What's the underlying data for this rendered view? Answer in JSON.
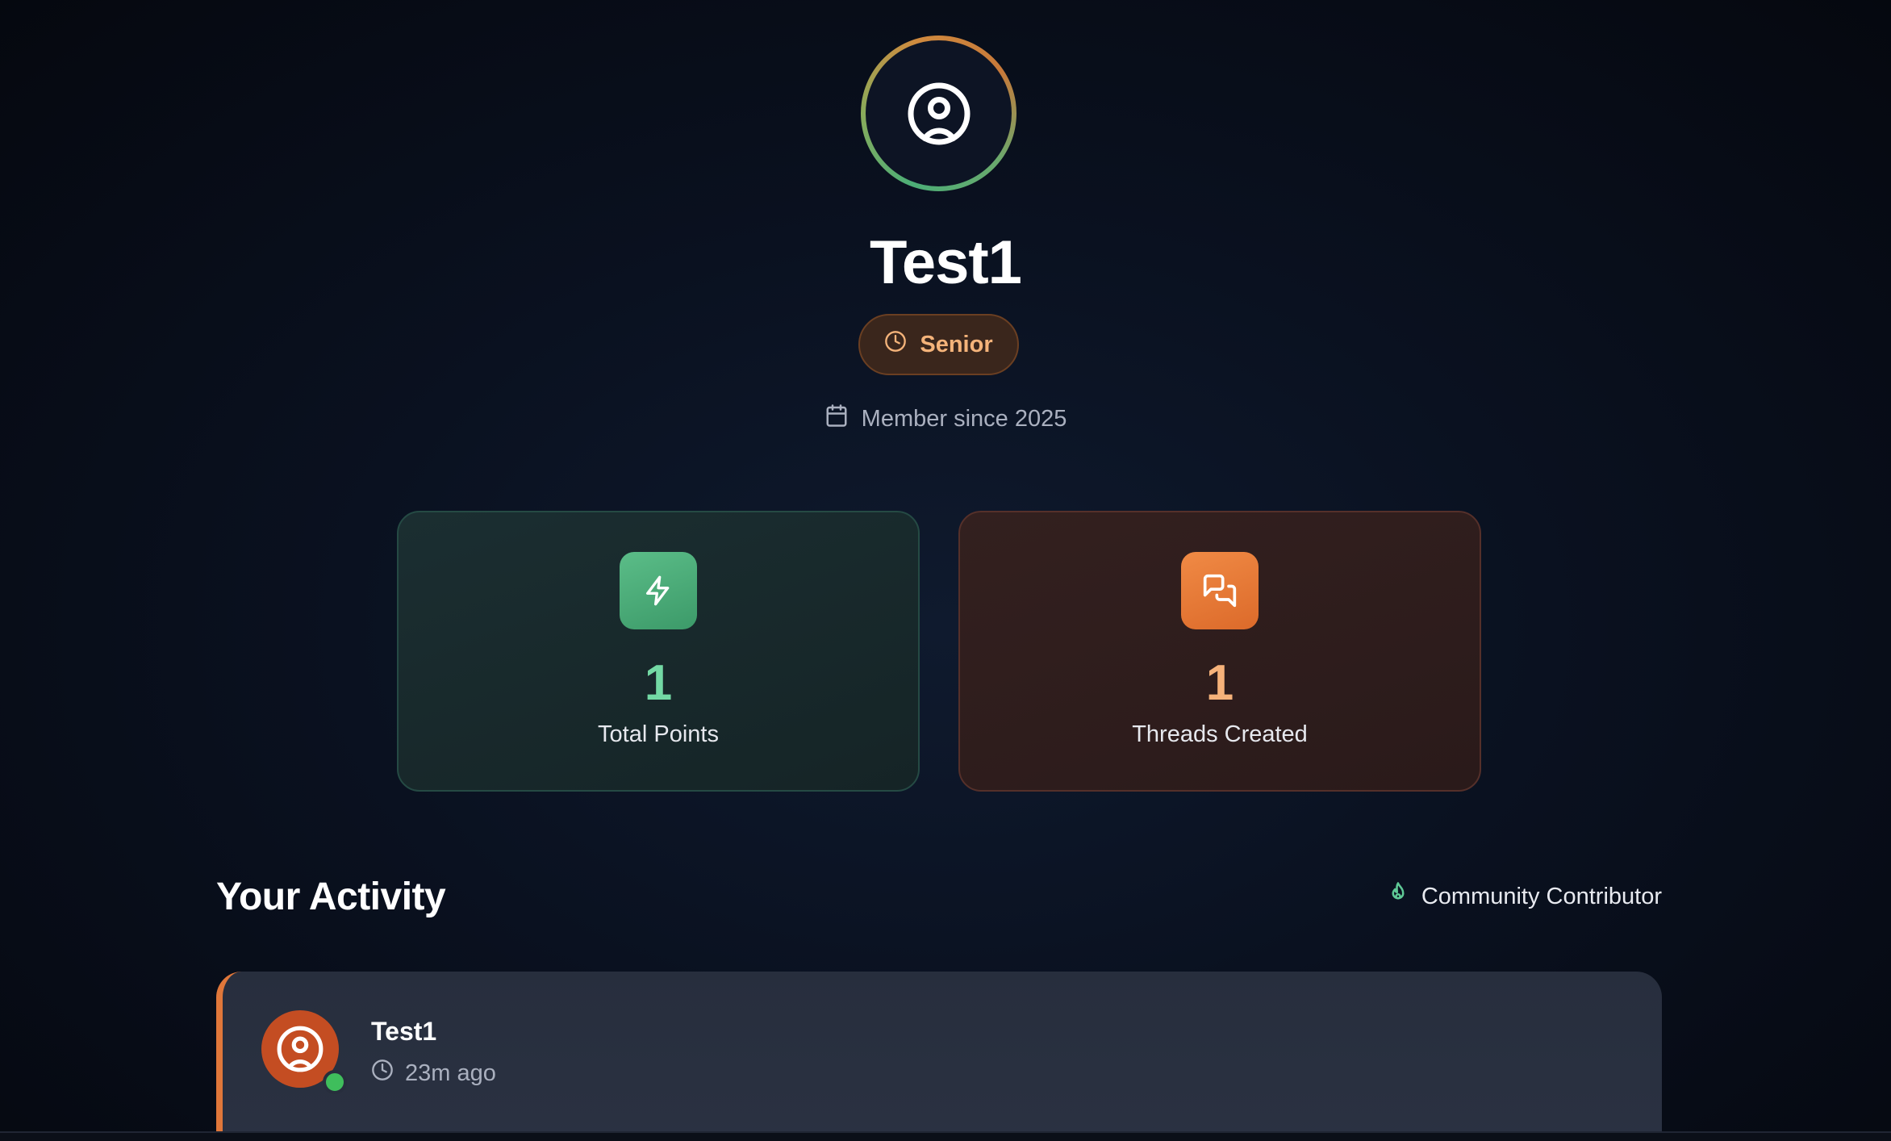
{
  "profile": {
    "name": "Test1",
    "rank": "Senior",
    "member_since": "Member since 2025"
  },
  "stats": [
    {
      "value": "1",
      "label": "Total Points",
      "icon": "lightning-icon",
      "accent": "#4caf7d"
    },
    {
      "value": "1",
      "label": "Threads Created",
      "icon": "chat-bubbles-icon",
      "accent": "#e97a36"
    }
  ],
  "activity": {
    "title": "Your Activity",
    "badge": "Community Contributor",
    "posts": [
      {
        "author": "Test1",
        "time": "23m ago",
        "body": ""
      }
    ]
  },
  "colors": {
    "green_accent": "#73d9a4",
    "orange_accent": "#f6b27a",
    "online": "#3fbe5c"
  }
}
